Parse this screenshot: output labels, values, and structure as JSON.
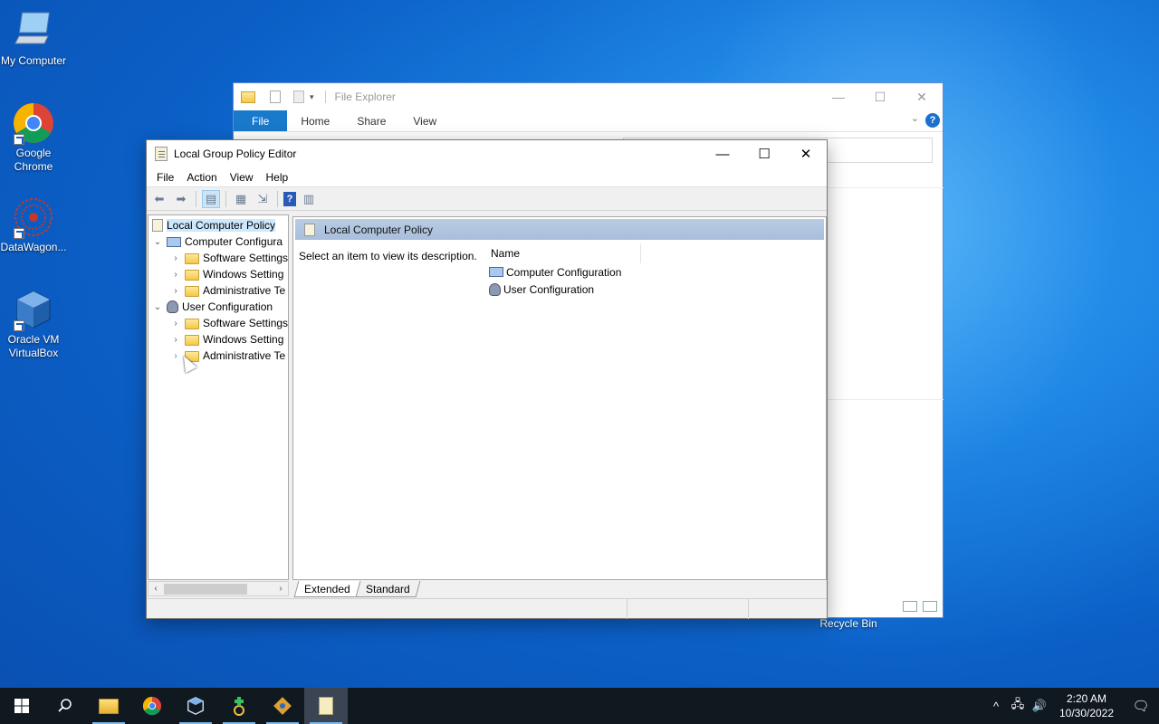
{
  "desktop": {
    "icons": [
      {
        "label": "My Computer"
      },
      {
        "label": "Google Chrome"
      },
      {
        "label": "DataWagon..."
      },
      {
        "label": "Oracle VM VirtualBox"
      }
    ],
    "recycle_bin": "Recycle Bin"
  },
  "file_explorer": {
    "title": "File Explorer",
    "tabs": [
      "File",
      "Home",
      "Share",
      "View"
    ],
    "controls": {
      "minimize": "—",
      "maximize": "☐",
      "close": "✕"
    },
    "help": "?"
  },
  "gpedit": {
    "title": "Local Group Policy Editor",
    "menu": [
      "File",
      "Action",
      "View",
      "Help"
    ],
    "controls": {
      "minimize": "—",
      "maximize": "☐",
      "close": "✕"
    },
    "tree": {
      "root": "Local Computer Policy",
      "computer_config": "Computer Configura",
      "cc_children": [
        "Software Settings",
        "Windows Setting",
        "Administrative Te"
      ],
      "user_config": "User Configuration",
      "uc_children": [
        "Software Settings",
        "Windows Setting",
        "Administrative Te"
      ]
    },
    "right": {
      "header": "Local Computer Policy",
      "description": "Select an item to view its description.",
      "column_name": "Name",
      "items": [
        "Computer Configuration",
        "User Configuration"
      ]
    },
    "tabs": [
      "Extended",
      "Standard"
    ]
  },
  "taskbar": {
    "time": "2:20 AM",
    "date": "10/30/2022"
  }
}
